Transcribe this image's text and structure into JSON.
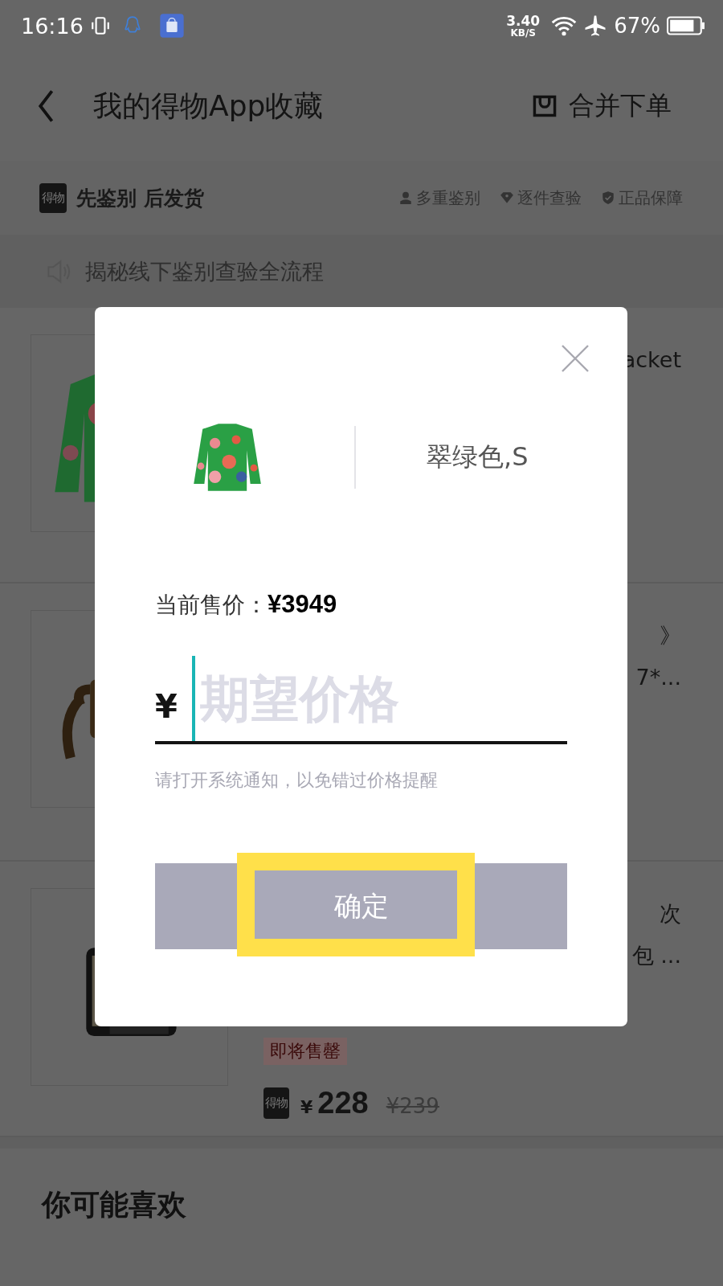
{
  "status_bar": {
    "time": "16:16",
    "network_speed": "3.40",
    "network_unit": "KB/S",
    "battery": "67%"
  },
  "header": {
    "title": "我的得物App收藏",
    "action": "合并下单"
  },
  "assurance": {
    "badge": "得物",
    "slogan": "先鉴别 后发货",
    "features": [
      "多重鉴别",
      "逐件查验",
      "正品保障"
    ]
  },
  "notice": "揭秘线下鉴别查验全流程",
  "products": [
    {
      "title_lines": [
        "acket"
      ]
    },
    {
      "title_lines": [
        "》",
        "7*..."
      ]
    },
    {
      "title_lines": [
        "次",
        "包 ..."
      ],
      "tag": "即将售罄",
      "badge": "得物",
      "currency": "¥",
      "price": "228",
      "original_price": "¥239"
    }
  ],
  "section_title": "你可能喜欢",
  "dialog": {
    "variant": "翠绿色,S",
    "price_label": "当前售价：",
    "price": "¥3949",
    "currency": "¥",
    "placeholder": "期望价格",
    "hint": "请打开系统通知，以免错过价格提醒",
    "confirm": "确定"
  }
}
